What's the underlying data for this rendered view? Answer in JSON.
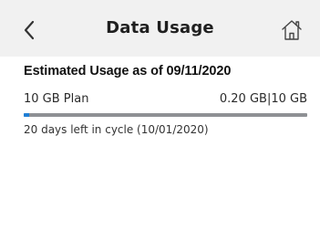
{
  "header": {
    "title": "Data Usage",
    "back_icon": "chevron-left-icon",
    "home_icon": "home-icon"
  },
  "usage": {
    "heading": "Estimated Usage as of 09/11/2020",
    "plan_name": "10 GB Plan",
    "used_of_total": "0.20 GB|10 GB",
    "used_fraction": 0.02,
    "days_left_text": "20 days left in cycle (10/01/2020)"
  },
  "colors": {
    "header_bg": "#f1f1f1",
    "progress_fill": "#1f7fd6",
    "progress_track": "#8e9094"
  }
}
